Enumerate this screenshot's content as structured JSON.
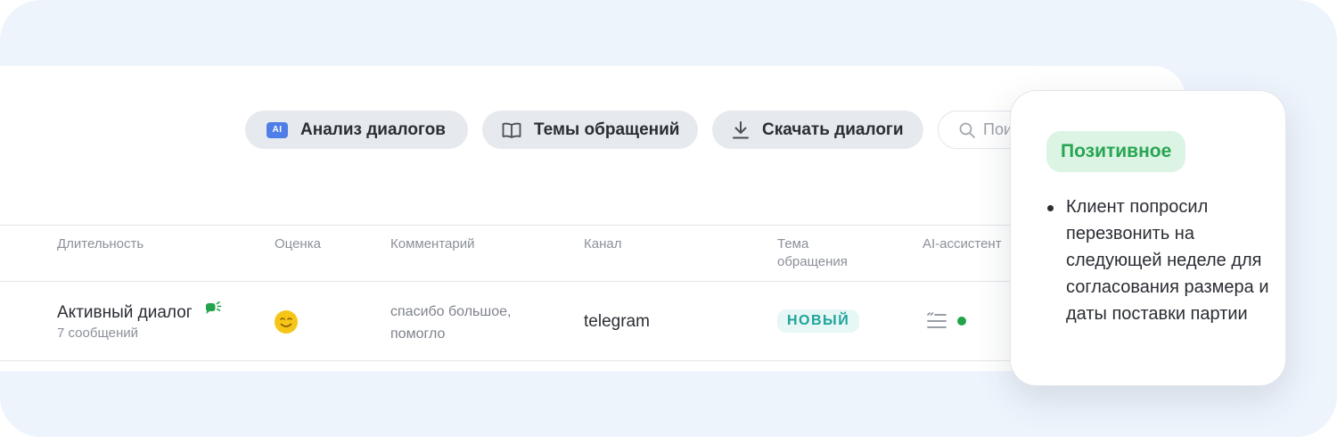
{
  "toolbar": {
    "ai_badge": "AI",
    "analysis_label": "Анализ диалогов",
    "topics_label": "Темы обращений",
    "download_label": "Скачать диалоги",
    "search_placeholder": "Поиск"
  },
  "table": {
    "headers": {
      "duration": "Длительность",
      "rating": "Оценка",
      "comment": "Комментарий",
      "channel": "Канал",
      "topic_line1": "Тема",
      "topic_line2": "обращения",
      "assistant": "AI-ассистент"
    },
    "row": {
      "status": "Активный диалог",
      "messages": "7 сообщений",
      "comment_line1": "спасибо большое,",
      "comment_line2": "помогло",
      "channel": "telegram",
      "topic": "НОВЫЙ"
    }
  },
  "popup": {
    "sentiment": "Позитивное",
    "summary": "Клиент попросил перезвонить на следующей неделе для согласования размера и даты поставки партии"
  },
  "colors": {
    "accent_blue": "#4f7fe6",
    "positive_green": "#27a552",
    "tag_teal": "#1fa39a",
    "status_dot": "#23a34b",
    "emoji_yellow": "#f5c518"
  }
}
